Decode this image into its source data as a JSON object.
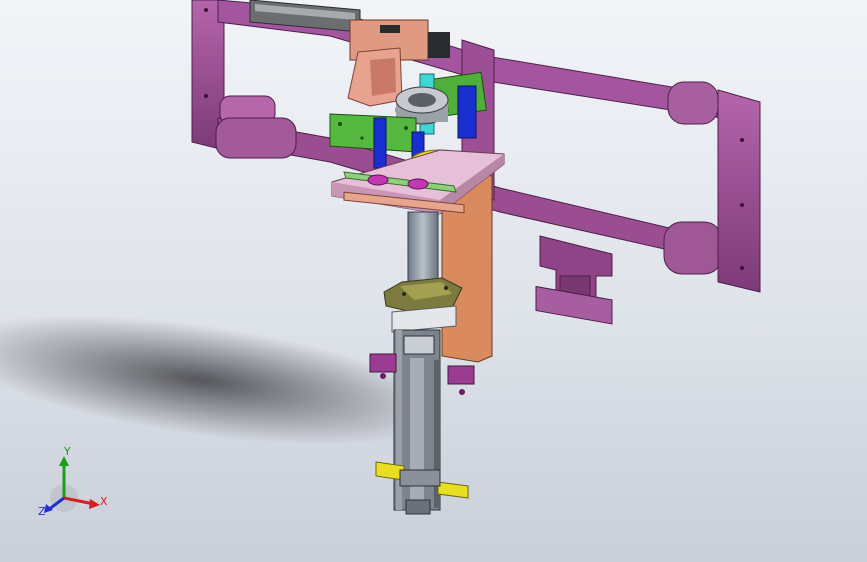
{
  "viewport": {
    "background_top": "#f2f4f8",
    "background_bottom": "#c9ced8"
  },
  "model": {
    "frame_color": "#9b4d92",
    "frame_dark": "#6e2f6a",
    "plate_color": "#e6c0d8",
    "bracket_color": "#d98a5e",
    "pcb_color": "#4faf3a",
    "column_color": "#8f99a6",
    "base_color": "#7c7a3e",
    "accent_blue": "#1a2fd0",
    "accent_yellow": "#e8df22",
    "accent_cyan": "#3fd6d6",
    "accent_salmon": "#e8a290"
  },
  "triad": {
    "x_label": "X",
    "y_label": "Y",
    "z_label": "Z",
    "x_color": "#d22020",
    "y_color": "#18a018",
    "z_color": "#2030d0"
  }
}
